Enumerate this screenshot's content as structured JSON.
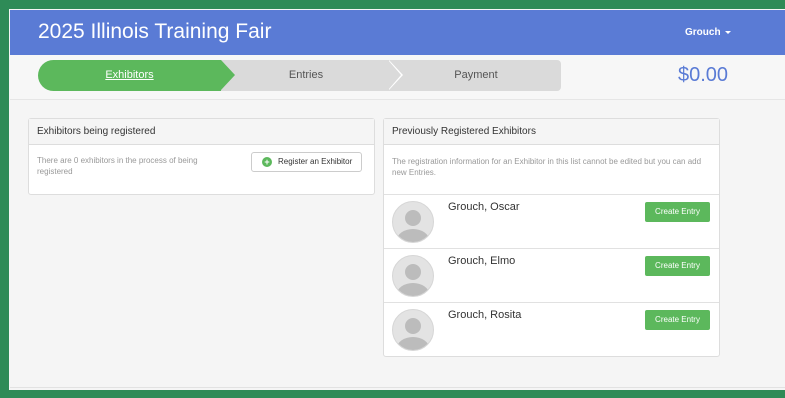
{
  "app": {
    "title": "2025 Illinois Training Fair"
  },
  "user_menu": {
    "label": "Grouch"
  },
  "steps": [
    "Exhibitors",
    "Entries",
    "Payment"
  ],
  "cart": {
    "total": "$0.00"
  },
  "pending_panel": {
    "title": "Exhibitors being registered",
    "note": "There are 0 exhibitors in the process of being registered",
    "button_label": "Register an Exhibitor"
  },
  "previous_panel": {
    "title": "Previously Registered Exhibitors",
    "note": "The registration information for an Exhibitor in this list cannot be edited but you can add new Entries.",
    "exhibitors": [
      {
        "name": "Grouch, Oscar",
        "action": "Create Entry"
      },
      {
        "name": "Grouch, Elmo",
        "action": "Create Entry"
      },
      {
        "name": "Grouch, Rosita",
        "action": "Create Entry"
      }
    ]
  },
  "colors": {
    "header": "#5a7bd5",
    "success": "#5cb85c",
    "frame": "#2e8b57"
  }
}
